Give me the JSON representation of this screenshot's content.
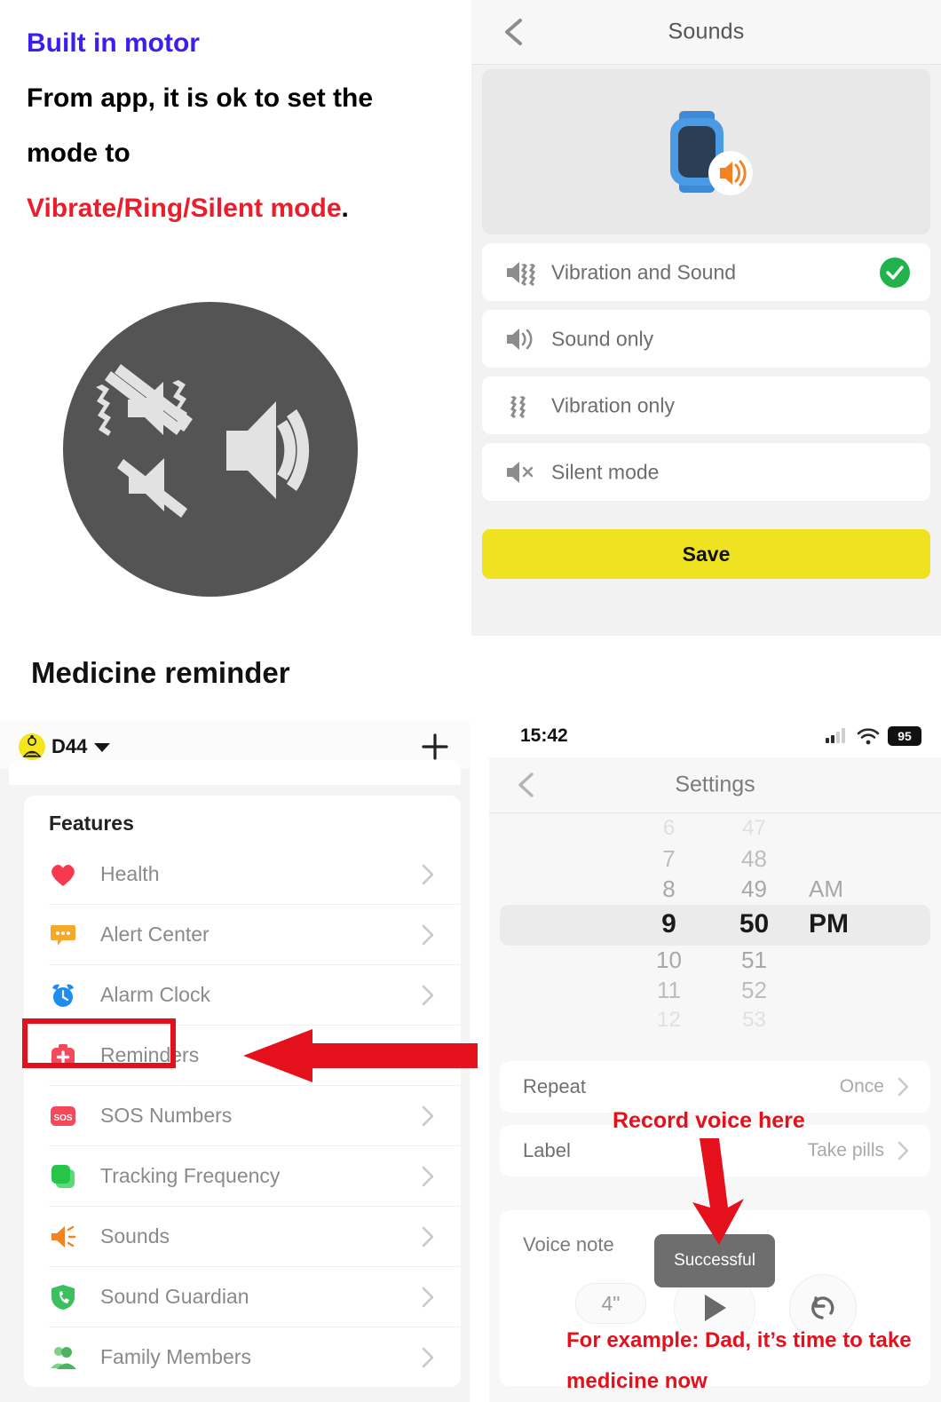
{
  "caption": {
    "line1": "Built in motor",
    "line2": "From app, it is ok to set the",
    "line3": "mode to",
    "line4_red": "Vibrate/Ring/Silent mode",
    "line4_period": ".",
    "colors": {
      "blue": "#3A1FEF",
      "black": "#000000",
      "red": "#ED1C2A"
    }
  },
  "silent_graphic": {
    "name": "silent-mode-illustration",
    "circle_color": "#545454",
    "icon_color": "#e0e0e0",
    "icons": [
      "vibrate-muted-icon",
      "speaker-muted-icon",
      "speaker-on-icon"
    ]
  },
  "sounds_screen": {
    "title": "Sounds",
    "back_icon": "chevron-left-icon",
    "hero_icon": "smartwatch-speaker-icon",
    "hero_colors": {
      "watch_band": "#4a90e2",
      "watch_screen": "#2c3e54",
      "speaker": "#f58220"
    },
    "options": [
      {
        "label": "Vibration and Sound",
        "icon": "speaker-vibration-icon",
        "selected": true
      },
      {
        "label": "Sound only",
        "icon": "speaker-waves-icon",
        "selected": false
      },
      {
        "label": "Vibration only",
        "icon": "vibration-icon",
        "selected": false
      },
      {
        "label": "Silent mode",
        "icon": "speaker-mute-icon",
        "selected": false
      }
    ],
    "check_color": "#22b24c",
    "save_label": "Save",
    "save_color": "#EFE321"
  },
  "medicine_heading": "Medicine reminder",
  "features_screen": {
    "device_name": "D44",
    "avatar_icon": "user-avatar-icon",
    "caret_icon": "chevron-down-icon",
    "add_icon": "plus-icon",
    "section_title": "Features",
    "items": [
      {
        "label": "Health",
        "icon": "heart-icon",
        "color": "#f7384f",
        "highlighted": false
      },
      {
        "label": "Alert Center",
        "icon": "chat-bubble-icon",
        "color": "#f6a828",
        "highlighted": false
      },
      {
        "label": "Alarm Clock",
        "icon": "alarm-clock-icon",
        "color": "#1f8cf0",
        "highlighted": false
      },
      {
        "label": "Reminders",
        "icon": "medical-kit-icon",
        "color": "#f4495a",
        "highlighted": true
      },
      {
        "label": "SOS Numbers",
        "icon": "sos-icon",
        "color": "#f4495a",
        "highlighted": false
      },
      {
        "label": "Tracking Frequency",
        "icon": "layers-icon",
        "color": "#27c44a",
        "highlighted": false
      },
      {
        "label": "Sounds",
        "icon": "speaker-icon",
        "color": "#f58220",
        "highlighted": false
      },
      {
        "label": "Sound Guardian",
        "icon": "shield-phone-icon",
        "color": "#3cbf5d",
        "highlighted": false
      },
      {
        "label": "Family Members",
        "icon": "people-icon",
        "color": "#5cbe6a",
        "highlighted": false
      }
    ],
    "chevron_icon": "chevron-right-icon",
    "highlight_color": "#E4111D",
    "arrow_icon": "left-arrow-annotation"
  },
  "settings_screen": {
    "status_bar": {
      "time": "15:42",
      "signal_icon": "cellular-signal-icon",
      "wifi_icon": "wifi-icon",
      "battery_level": "95"
    },
    "title": "Settings",
    "back_icon": "chevron-left-icon",
    "time_picker": {
      "hours": [
        "6",
        "7",
        "8",
        "9",
        "10",
        "11",
        "12"
      ],
      "minutes": [
        "47",
        "48",
        "49",
        "50",
        "51",
        "52",
        "53"
      ],
      "periods": [
        "AM",
        "PM"
      ],
      "selected_hour": "9",
      "selected_minute": "50",
      "selected_period": "PM"
    },
    "rows": [
      {
        "label": "Repeat",
        "value": "Once"
      },
      {
        "label": "Label",
        "value": "Take pills"
      }
    ],
    "voice_note": {
      "title": "Voice note",
      "duration": "4\"",
      "play_icon": "play-icon",
      "redo_icon": "redo-icon",
      "toast": "Successful"
    },
    "annotations": {
      "record_here": "Record voice here",
      "example": "For example: Dad, it’s time to take medicine now",
      "arrow_icon": "down-arrow-annotation",
      "color": "#E4111D"
    }
  }
}
